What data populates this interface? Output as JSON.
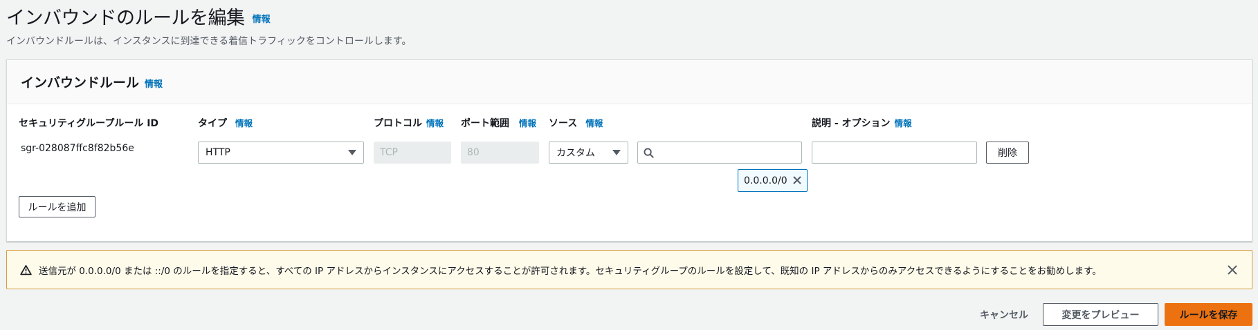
{
  "header": {
    "title": "インバウンドのルールを編集",
    "info": "情報",
    "description": "インバウンドルールは、インスタンスに到達できる着信トラフィックをコントロールします。"
  },
  "panel": {
    "title": "インバウンドルール",
    "info": "情報",
    "columns": {
      "rule_id": "セキュリティグループルール ID",
      "type": "タイプ",
      "protocol": "プロトコル",
      "port_range": "ポート範囲",
      "source": "ソース",
      "description": "説明 - オプション",
      "info": "情報"
    },
    "rule": {
      "id": "sgr-028087ffc8f82b56e",
      "type": "HTTP",
      "protocol": "TCP",
      "port_range": "80",
      "source_type": "カスタム",
      "source_search": "",
      "source_token": "0.0.0.0/0",
      "description": "",
      "delete_label": "削除"
    },
    "add_rule_label": "ルールを追加"
  },
  "warning": {
    "text": "送信元が 0.0.0.0/0 または ::/0 のルールを指定すると、すべての IP アドレスからインスタンスにアクセスすることが許可されます。セキュリティグループのルールを設定して、既知の IP アドレスからのみアクセスできるようにすることをお勧めします。"
  },
  "footer": {
    "cancel_label": "キャンセル",
    "preview_label": "変更をプレビュー",
    "save_label": "ルールを保存"
  },
  "colors": {
    "link": "#0073bb",
    "primary": "#ec7211",
    "warning_bg": "#fffbeb",
    "warning_border": "#d69a3d"
  },
  "icons": {
    "search": "search-icon",
    "token_remove": "close-icon",
    "warning": "warning-icon",
    "dismiss": "close-icon"
  }
}
